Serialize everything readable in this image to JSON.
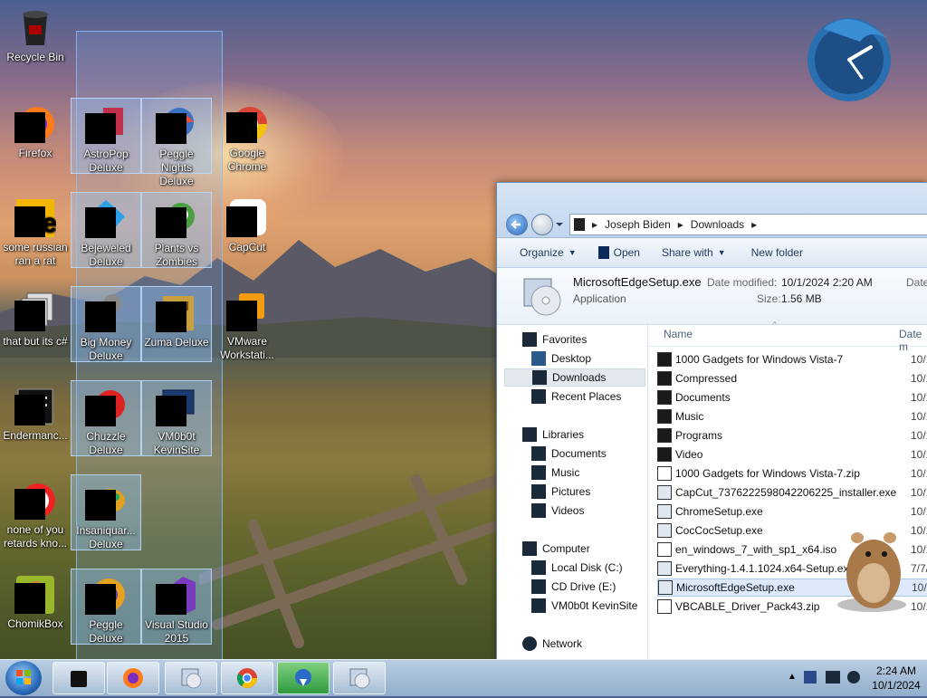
{
  "desktop": {
    "icons": [
      {
        "label": "Recycle Bin",
        "icon": "recycle-bin-icon"
      },
      {
        "label": "Firefox",
        "icon": "firefox-icon"
      },
      {
        "label": "some russian ran a rat",
        "icon": "app-icon"
      },
      {
        "label": "that but its c#",
        "icon": "app-icon"
      },
      {
        "label": "Endermanc...",
        "icon": "app-icon"
      },
      {
        "label": "none of you retards kno...",
        "icon": "app-icon"
      },
      {
        "label": "ChomikBox",
        "icon": "chomikbox-icon"
      },
      {
        "label": "AstroPop Deluxe",
        "icon": "game-icon"
      },
      {
        "label": "Bejeweled Deluxe",
        "icon": "game-icon"
      },
      {
        "label": "Big Money Deluxe",
        "icon": "game-icon"
      },
      {
        "label": "Chuzzle Deluxe",
        "icon": "game-icon"
      },
      {
        "label": "Insaniquar... Deluxe",
        "icon": "game-icon"
      },
      {
        "label": "Peggle Deluxe",
        "icon": "game-icon"
      },
      {
        "label": "Peggle Nights Deluxe",
        "icon": "game-icon"
      },
      {
        "label": "Plants vs Zombies",
        "icon": "game-icon"
      },
      {
        "label": "Zuma Deluxe",
        "icon": "game-icon"
      },
      {
        "label": "VM0b0t KevinSite",
        "icon": "monitor-icon"
      },
      {
        "label": "Visual Studio 2015",
        "icon": "visual-studio-icon"
      },
      {
        "label": "Google Chrome",
        "icon": "chrome-icon"
      },
      {
        "label": "CapCut",
        "icon": "capcut-icon"
      },
      {
        "label": "VMware Workstati...",
        "icon": "vmware-icon"
      }
    ]
  },
  "explorer": {
    "breadcrumb": [
      "Joseph Biden",
      "Downloads"
    ],
    "toolbar": {
      "organize": "Organize",
      "open": "Open",
      "share_with": "Share with",
      "new_folder": "New folder"
    },
    "details": {
      "filename": "MicrosoftEdgeSetup.exe",
      "type": "Application",
      "date_modified_label": "Date modified:",
      "date_modified": "10/1/2024 2:20 AM",
      "size_label": "Size:",
      "size": "1.56 MB",
      "trailing": "Date"
    },
    "nav": {
      "favorites": "Favorites",
      "desktop": "Desktop",
      "downloads": "Downloads",
      "recent_places": "Recent Places",
      "libraries": "Libraries",
      "documents": "Documents",
      "music": "Music",
      "pictures": "Pictures",
      "videos": "Videos",
      "computer": "Computer",
      "local_disk": "Local Disk (C:)",
      "cd_drive": "CD Drive (E:)",
      "vm_site": "VM0b0t KevinSite",
      "network": "Network"
    },
    "columns": {
      "name": "Name",
      "date": "Date m"
    },
    "files": [
      {
        "name": "1000 Gadgets for Windows Vista-7",
        "date": "10/1/",
        "icon": "folder-icon"
      },
      {
        "name": "Compressed",
        "date": "10/1/",
        "icon": "folder-icon"
      },
      {
        "name": "Documents",
        "date": "10/1/",
        "icon": "folder-icon"
      },
      {
        "name": "Music",
        "date": "10/1/",
        "icon": "folder-icon"
      },
      {
        "name": "Programs",
        "date": "10/1/",
        "icon": "folder-icon"
      },
      {
        "name": "Video",
        "date": "10/1/",
        "icon": "folder-icon"
      },
      {
        "name": "1000 Gadgets for Windows Vista-7.zip",
        "date": "10/1/",
        "icon": "zip-icon"
      },
      {
        "name": "CapCut_7376222598042206225_installer.exe",
        "date": "10/1/",
        "icon": "exe-icon"
      },
      {
        "name": "ChromeSetup.exe",
        "date": "10/1/",
        "icon": "exe-icon"
      },
      {
        "name": "CocCocSetup.exe",
        "date": "10/1/",
        "icon": "exe-icon"
      },
      {
        "name": "en_windows_7_with_sp1_x64.iso",
        "date": "10/1/",
        "icon": "iso-icon"
      },
      {
        "name": "Everything-1.4.1.1024.x64-Setup.exe",
        "date": "7/7/20",
        "icon": "exe-icon"
      },
      {
        "name": "MicrosoftEdgeSetup.exe",
        "date": "10/1/",
        "icon": "exe-icon"
      },
      {
        "name": "VBCABLE_Driver_Pack43.zip",
        "date": "10/1/",
        "icon": "zip-icon"
      }
    ]
  },
  "taskbar": {
    "time": "2:24 AM",
    "date": "10/1/2024"
  }
}
